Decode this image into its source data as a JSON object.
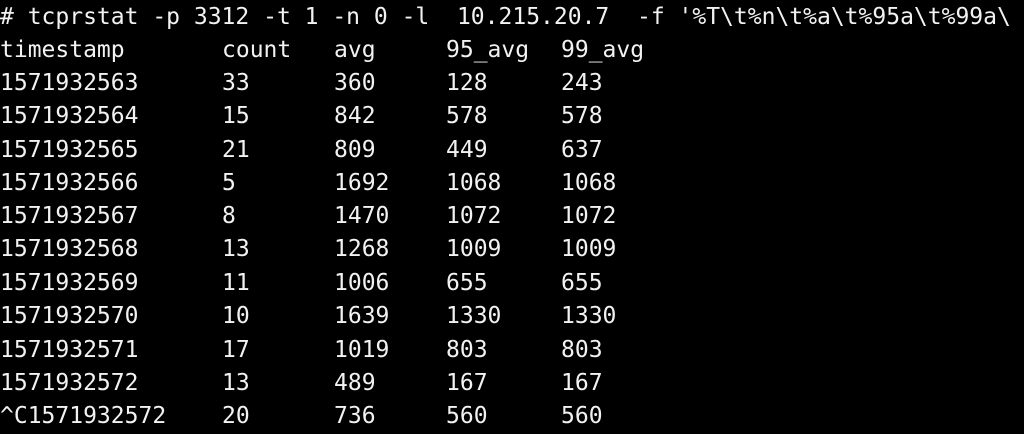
{
  "terminal": {
    "command_line": "# tcprstat -p 3312 -t 1 -n 0 -l  10.215.20.7  -f '%T\\t%n\\t%a\\t%95a\\t%99a\\",
    "headers": [
      "timestamp",
      "count",
      "avg",
      "95_avg",
      "99_avg"
    ],
    "rows": [
      [
        "1571932563",
        "33",
        "360",
        "128",
        "243"
      ],
      [
        "1571932564",
        "15",
        "842",
        "578",
        "578"
      ],
      [
        "1571932565",
        "21",
        "809",
        "449",
        "637"
      ],
      [
        "1571932566",
        "5",
        "1692",
        "1068",
        "1068"
      ],
      [
        "1571932567",
        "8",
        "1470",
        "1072",
        "1072"
      ],
      [
        "1571932568",
        "13",
        "1268",
        "1009",
        "1009"
      ],
      [
        "1571932569",
        "11",
        "1006",
        "655",
        "655"
      ],
      [
        "1571932570",
        "10",
        "1639",
        "1330",
        "1330"
      ],
      [
        "1571932571",
        "17",
        "1019",
        "803",
        "803"
      ],
      [
        "1571932572",
        "13",
        "489",
        "167",
        "167"
      ],
      [
        "^C1571932572",
        "20",
        "736",
        "560",
        "560"
      ]
    ],
    "colors": {
      "background": "#000000",
      "foreground": "#f2f2f2"
    }
  }
}
